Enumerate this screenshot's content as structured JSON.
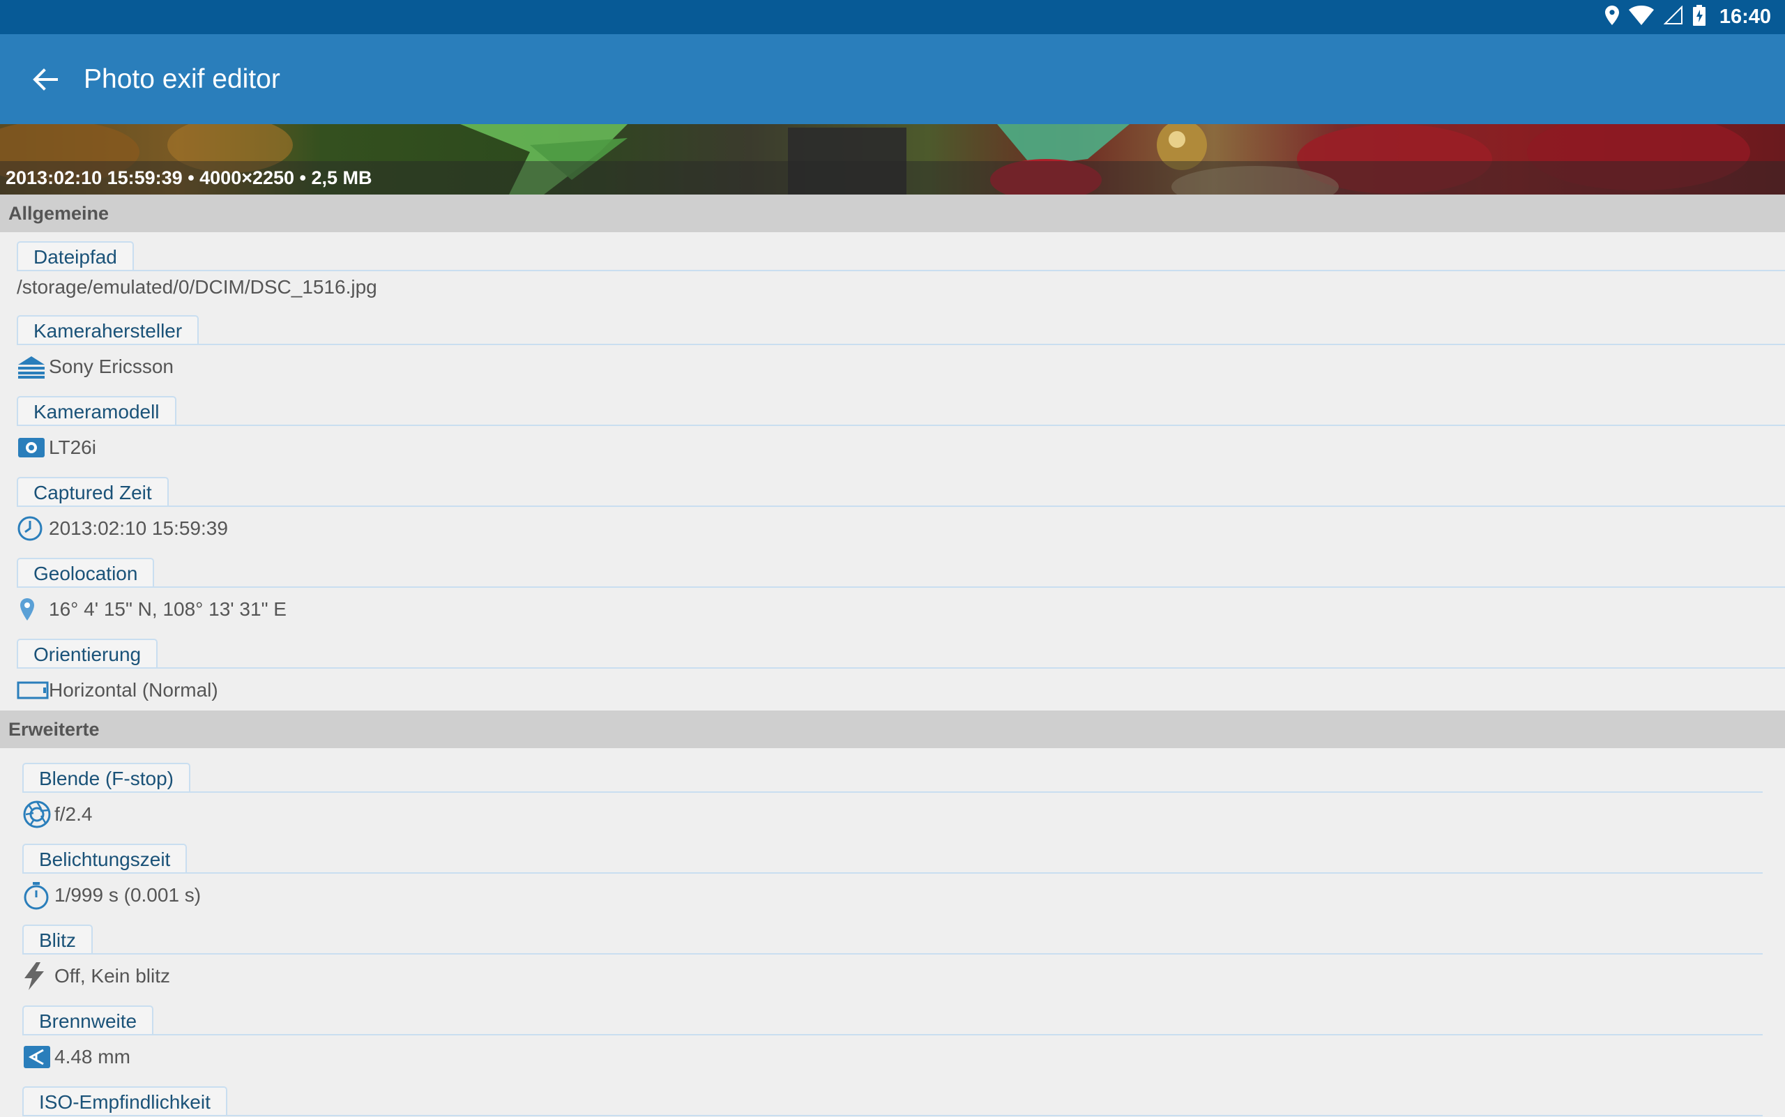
{
  "status_bar": {
    "time": "16:40",
    "icons": [
      "location-icon",
      "wifi-icon",
      "signal-icon",
      "battery-charging-icon"
    ]
  },
  "app_bar": {
    "title": "Photo exif editor",
    "back_icon": "arrow-back-icon"
  },
  "banner": {
    "caption": "2013:02:10 15:59:39 • 4000×2250 • 2,5 MB"
  },
  "sections": {
    "general": {
      "title": "Allgemeine",
      "fields": [
        {
          "label": "Dateipfad",
          "value": "/storage/emulated/0/DCIM/DSC_1516.jpg",
          "icon": ""
        },
        {
          "label": "Kamerahersteller",
          "value": "Sony Ericsson",
          "icon": "manufacturer-icon"
        },
        {
          "label": "Kameramodell",
          "value": "LT26i",
          "icon": "camera-icon"
        },
        {
          "label": "Captured Zeit",
          "value": "2013:02:10 15:59:39",
          "icon": "clock-icon"
        },
        {
          "label": "Geolocation",
          "value": "16° 4' 15\" N, 108° 13' 31\" E",
          "icon": "location-pin-icon"
        },
        {
          "label": "Orientierung",
          "value": "Horizontal (Normal)",
          "icon": "orientation-icon"
        }
      ]
    },
    "advanced": {
      "title": "Erweiterte",
      "fields": [
        {
          "label": "Blende (F-stop)",
          "value": "f/2.4",
          "icon": "aperture-icon"
        },
        {
          "label": "Belichtungszeit",
          "value": "1/999 s (0.001 s)",
          "icon": "timer-icon"
        },
        {
          "label": "Blitz",
          "value": "Off, Kein blitz",
          "icon": "flash-icon"
        },
        {
          "label": "Brennweite",
          "value": "4.48 mm",
          "icon": "focal-length-icon"
        },
        {
          "label": "ISO-Empfindlichkeit",
          "value": "",
          "icon": ""
        }
      ]
    }
  },
  "colors": {
    "status_bar": "#075a96",
    "app_bar": "#2a7ebb",
    "accent": "#2a7ebb",
    "section_bg": "#cfcfcf",
    "page_bg": "#efefef"
  }
}
